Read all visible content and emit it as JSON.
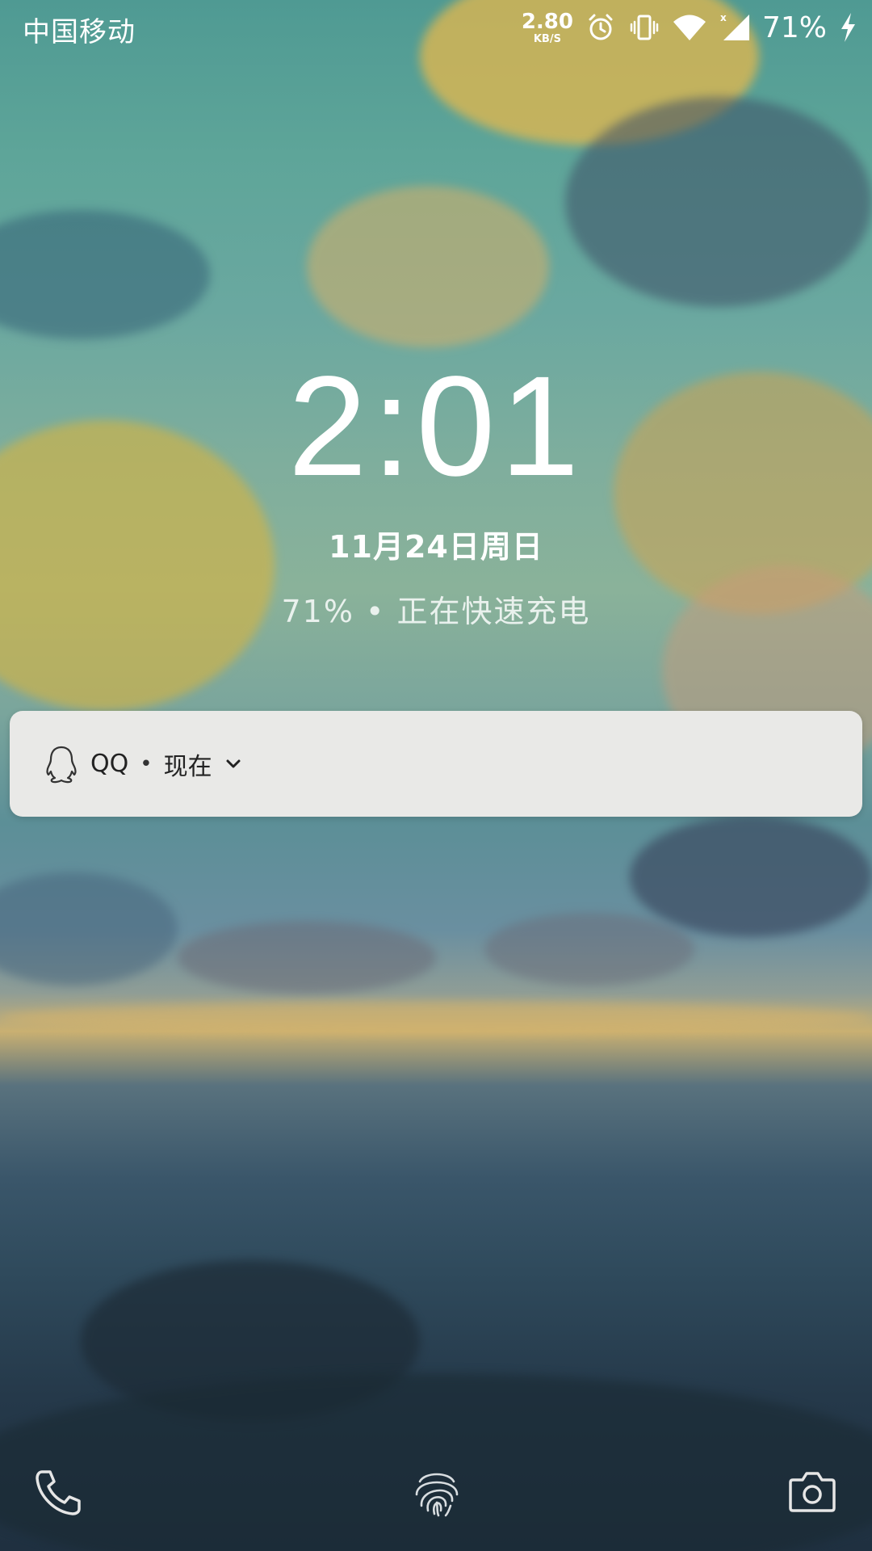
{
  "status_bar": {
    "carrier": "中国移动",
    "net_speed_value": "2.80",
    "net_speed_unit": "KB/S",
    "mobile_data_flag": "x",
    "battery_percent": "71%",
    "icons": [
      "alarm-icon",
      "vibrate-icon",
      "wifi-icon",
      "signal-icon",
      "charging-bolt-icon"
    ]
  },
  "lock_screen": {
    "time": "2:01",
    "date": "11月24日周日",
    "charging_status": "71% • 正在快速充电"
  },
  "notification": {
    "app_name": "QQ",
    "separator": "•",
    "time": "现在",
    "app_icon": "qq-penguin-icon",
    "expand_icon": "chevron-down-icon"
  },
  "shortcuts": {
    "left": "phone-icon",
    "center": "fingerprint-icon",
    "right": "camera-icon"
  }
}
